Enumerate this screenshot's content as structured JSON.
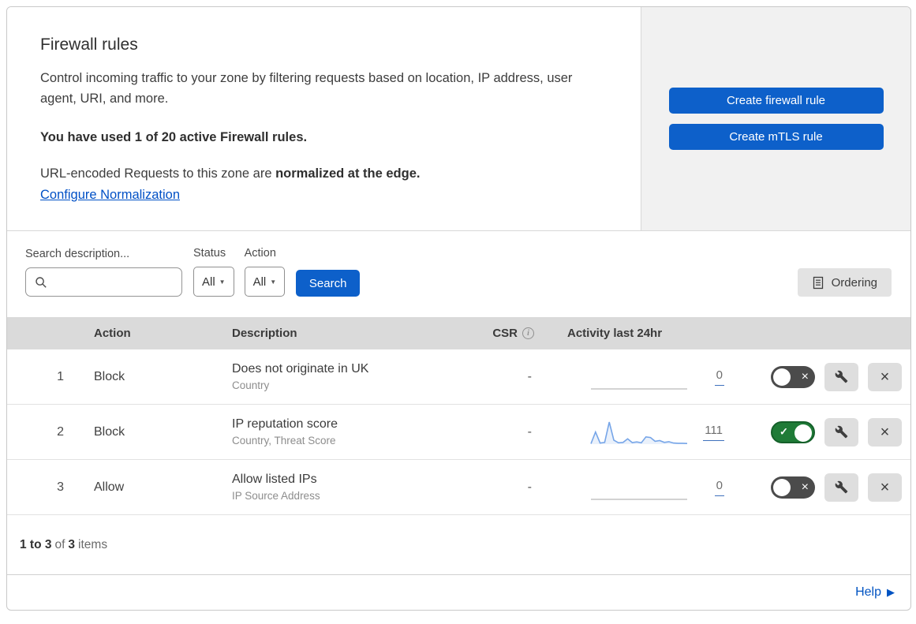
{
  "header": {
    "title": "Firewall rules",
    "description": "Control incoming traffic to your zone by filtering requests based on location, IP address, user agent, URI, and more.",
    "usage_line": "You have used 1 of 20 active Firewall rules.",
    "normalization_prefix": "URL-encoded Requests to this zone are ",
    "normalization_bold": "normalized at the edge.",
    "normalization_link": "Configure Normalization",
    "create_firewall_button": "Create firewall rule",
    "create_mtls_button": "Create mTLS rule"
  },
  "filters": {
    "search_label": "Search description...",
    "status_label": "Status",
    "status_value": "All",
    "action_label": "Action",
    "action_value": "All",
    "search_button": "Search",
    "ordering_button": "Ordering"
  },
  "table": {
    "columns": {
      "action": "Action",
      "description": "Description",
      "csr": "CSR",
      "activity": "Activity last 24hr"
    },
    "rows": [
      {
        "num": "1",
        "action": "Block",
        "description": "Does not originate in UK",
        "criteria": "Country",
        "csr": "-",
        "activity_count": "0",
        "enabled": false,
        "activity_series": []
      },
      {
        "num": "2",
        "action": "Block",
        "description": "IP reputation score",
        "criteria": "Country, Threat Score",
        "csr": "-",
        "activity_count": "111",
        "enabled": true,
        "activity_series": [
          2,
          55,
          5,
          8,
          100,
          18,
          6,
          8,
          24,
          7,
          10,
          6,
          33,
          30,
          13,
          16,
          8,
          11,
          5,
          4,
          4,
          3
        ]
      },
      {
        "num": "3",
        "action": "Allow",
        "description": "Allow listed IPs",
        "criteria": "IP Source Address",
        "csr": "-",
        "activity_count": "0",
        "enabled": false,
        "activity_series": []
      }
    ]
  },
  "chart_data": {
    "type": "line",
    "title": "Activity last 24hr sparkline (rule 2)",
    "x": [
      0,
      1,
      2,
      3,
      4,
      5,
      6,
      7,
      8,
      9,
      10,
      11,
      12,
      13,
      14,
      15,
      16,
      17,
      18,
      19,
      20,
      21
    ],
    "values": [
      2,
      55,
      5,
      8,
      100,
      18,
      6,
      8,
      24,
      7,
      10,
      6,
      33,
      30,
      13,
      16,
      8,
      11,
      5,
      4,
      4,
      3
    ],
    "total_last_24hr": 111,
    "grid": false,
    "legend": "none"
  },
  "footer": {
    "range_bold": "1 to 3",
    "of_text": "of",
    "total_bold": "3",
    "items_text": "items"
  },
  "help": {
    "label": "Help"
  },
  "glyphs": {
    "caret_down": "▼",
    "help_arrow": "▶",
    "toggle_x": "×",
    "toggle_check": "✓",
    "close_x": "×",
    "info_i": "i"
  },
  "colors": {
    "primary_blue": "#0d60ca",
    "link_blue": "#0050c6",
    "toggle_on_green": "#1f7b37",
    "toggle_off_gray": "#4b4b4b",
    "sparkline_blue": "#76a5e8",
    "table_header_gray": "#dadada",
    "panel_gray": "#f1f1f1"
  }
}
